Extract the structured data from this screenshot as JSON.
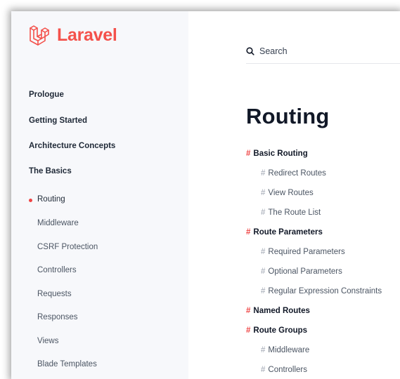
{
  "brand": {
    "name": "Laravel",
    "logo_icon": "laravel-logo-icon",
    "accent_color": "#f4514b"
  },
  "sidebar": {
    "sections": [
      {
        "label": "Prologue"
      },
      {
        "label": "Getting Started"
      },
      {
        "label": "Architecture Concepts"
      },
      {
        "label": "The Basics"
      }
    ],
    "items": [
      {
        "label": "Routing",
        "active": true
      },
      {
        "label": "Middleware"
      },
      {
        "label": "CSRF Protection"
      },
      {
        "label": "Controllers"
      },
      {
        "label": "Requests"
      },
      {
        "label": "Responses"
      },
      {
        "label": "Views"
      },
      {
        "label": "Blade Templates"
      }
    ]
  },
  "search": {
    "label": "Search",
    "icon": "search-icon"
  },
  "page": {
    "title": "Routing"
  },
  "toc": {
    "hash": "#",
    "entries": [
      {
        "label": "Basic Routing",
        "level": 1
      },
      {
        "label": "Redirect Routes",
        "level": 2
      },
      {
        "label": "View Routes",
        "level": 2
      },
      {
        "label": "The Route List",
        "level": 2
      },
      {
        "label": "Route Parameters",
        "level": 1
      },
      {
        "label": "Required Parameters",
        "level": 2
      },
      {
        "label": "Optional Parameters",
        "level": 2
      },
      {
        "label": "Regular Expression Constraints",
        "level": 2
      },
      {
        "label": "Named Routes",
        "level": 1
      },
      {
        "label": "Route Groups",
        "level": 1
      },
      {
        "label": "Middleware",
        "level": 2
      },
      {
        "label": "Controllers",
        "level": 2
      }
    ]
  }
}
